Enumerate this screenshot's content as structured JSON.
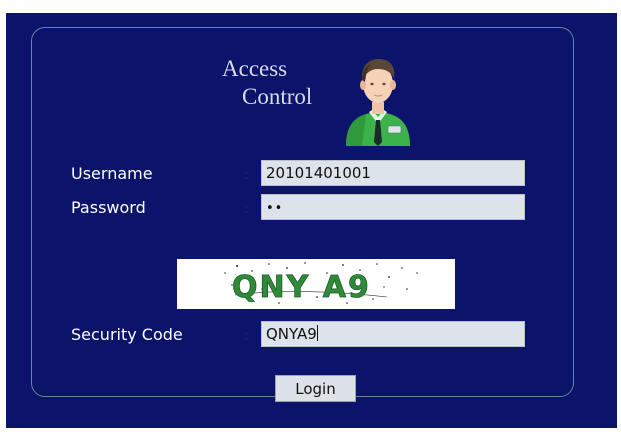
{
  "heading": {
    "line1": "Access",
    "line2": "Control"
  },
  "form": {
    "username_label": "Username",
    "password_label": "Password",
    "security_label": "Security Code",
    "colon": ":",
    "username_value": "20101401001",
    "password_value": "••",
    "security_value": "QNYA9"
  },
  "captcha": {
    "text": "QNY A9",
    "colors": {
      "text": "#2f8a3a",
      "noise": "#222222"
    }
  },
  "buttons": {
    "login_label": "Login"
  },
  "icons": {
    "avatar": "user-avatar-icon"
  },
  "colors": {
    "panel": "#0b136a",
    "frame_border": "#5f8a92",
    "field_bg": "#dde3ea",
    "label_text": "#ffffff"
  }
}
